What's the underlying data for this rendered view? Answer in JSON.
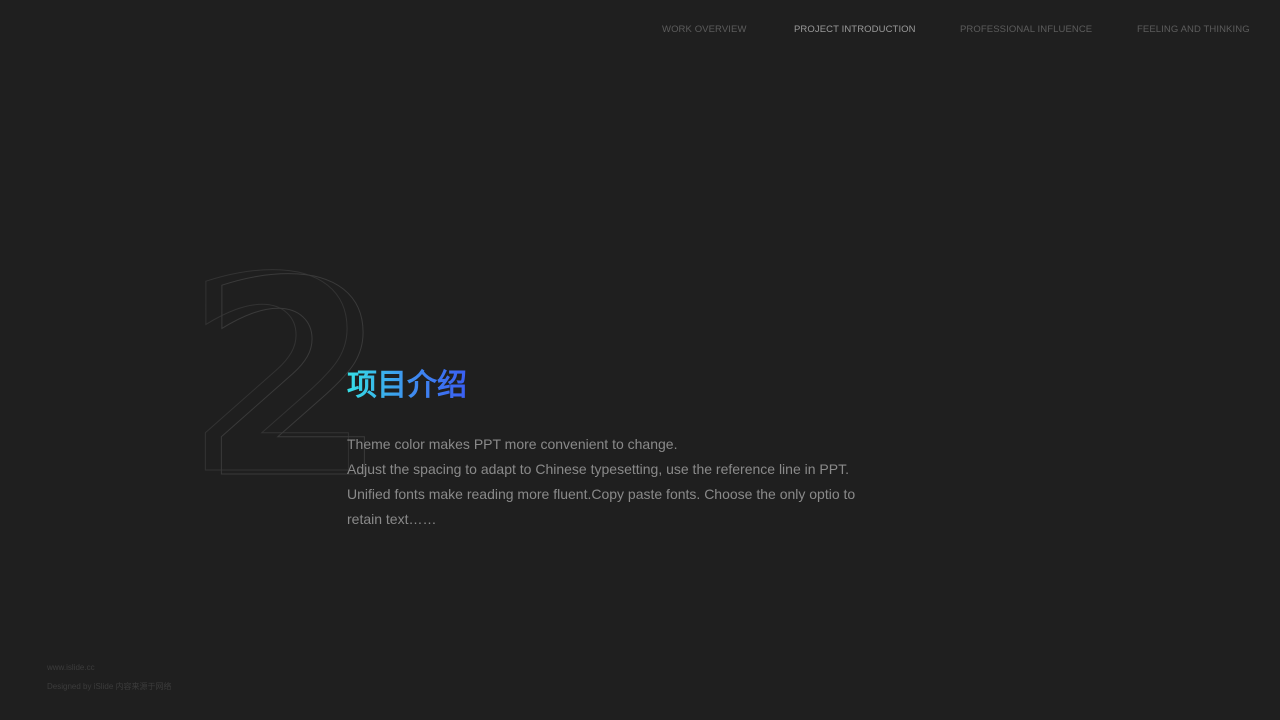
{
  "nav": {
    "items": [
      {
        "label": "WORK OVERVIEW"
      },
      {
        "label": "PROJECT INTRODUCTION"
      },
      {
        "label": "PROFESSIONAL INFLUENCE"
      },
      {
        "label": "FEELING AND THINKING"
      }
    ],
    "active_index": 1
  },
  "section": {
    "number": "2",
    "title": "项目介绍",
    "title_gradient": [
      "#35e0e6",
      "#3a5ef2"
    ],
    "body_lines": [
      "Theme  color makes PPT more convenient to change.",
      "Adjust the spacing to adapt to Chinese typesetting, use the reference line in PPT.",
      "Unified fonts make reading more fluent.Copy paste fonts. Choose the only optio to",
      "retain text……"
    ]
  },
  "footer": {
    "url": "www.islide.cc",
    "credit": "Designed by iSlide  内容来源于网络"
  },
  "colors": {
    "background": "#1f1f1f",
    "nav_text": "#5c5c5c",
    "nav_active": "#9a9a9a",
    "body_text": "#8a8a8a",
    "numeral_outline": "#3a3a3a"
  }
}
